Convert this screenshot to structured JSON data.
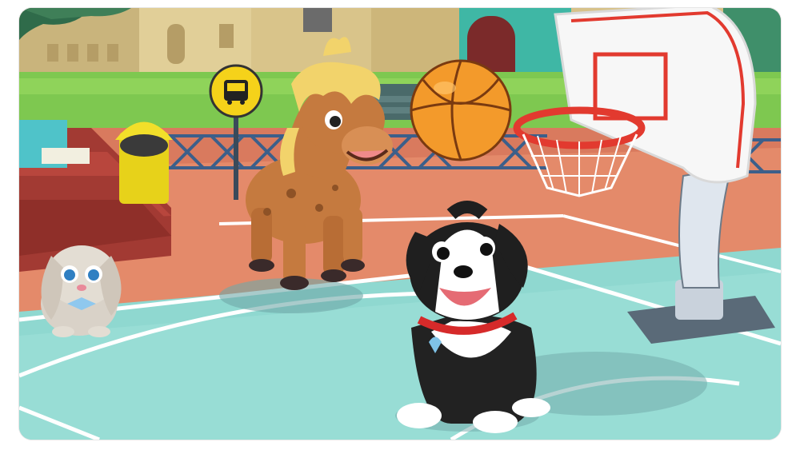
{
  "game": {
    "scene": "schoolyard-basketball-court",
    "hud": {},
    "characters": [
      {
        "name": "puppy",
        "icon": "dog-icon"
      },
      {
        "name": "pony",
        "icon": "pony-icon"
      },
      {
        "name": "bunny",
        "icon": "bunny-icon"
      }
    ],
    "objects": [
      {
        "name": "basketball",
        "icon": "basketball-icon"
      },
      {
        "name": "basketball-hoop",
        "icon": "hoop-icon"
      },
      {
        "name": "bus-stop-sign",
        "icon": "bus-icon"
      },
      {
        "name": "trash-can",
        "icon": "trash-can-icon"
      }
    ],
    "colors": {
      "court": "#8fd8d0",
      "court_lines": "#ffffff",
      "ground": "#e48a6a",
      "grass": "#7ec850",
      "building": "#d9c48a",
      "sky_dark_green": "#2f6b4a",
      "ball": "#f39a2b",
      "hoop_red": "#e23a2f",
      "collar_red": "#d62a2a",
      "sign_yellow": "#f5d21a"
    }
  }
}
